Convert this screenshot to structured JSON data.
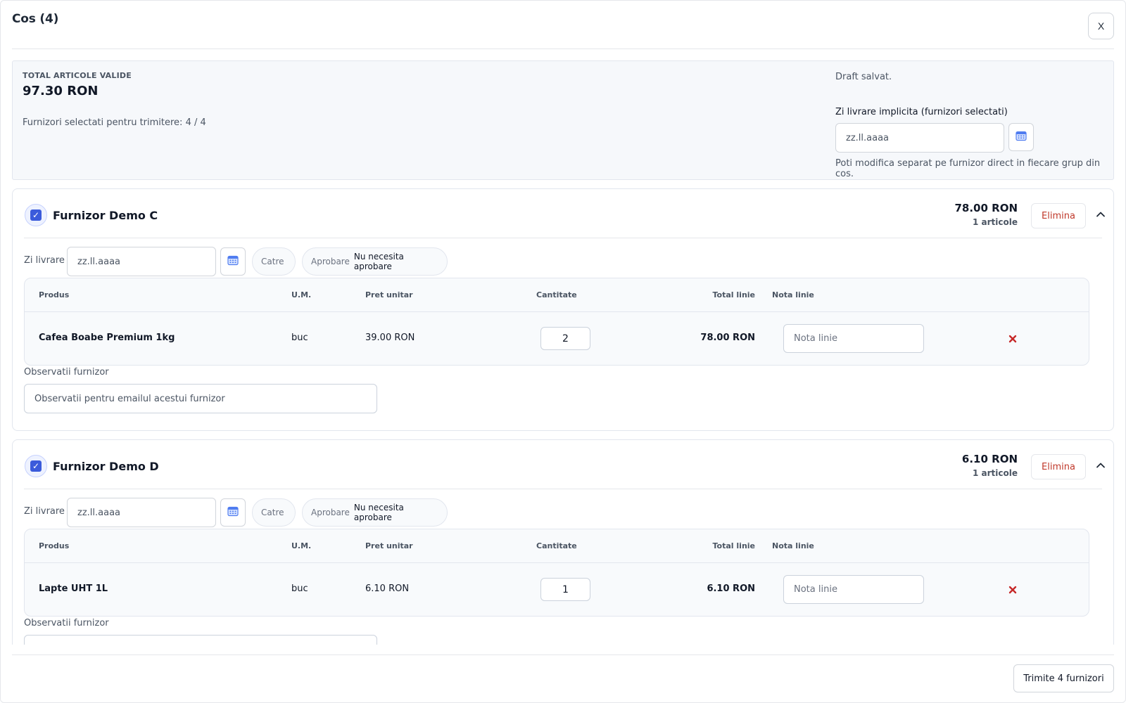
{
  "modal": {
    "title": "Cos (4)",
    "close_label": "X"
  },
  "summary": {
    "total_label": "TOTAL ARTICOLE VALIDE",
    "total_value": "97.30 RON",
    "suppliers_selected": "Furnizori selectati pentru trimitere: 4 / 4",
    "draft_status": "Draft salvat.",
    "default_day_label": "Zi livrare implicita (furnizori selectati)",
    "default_day_placeholder": "zz.ll.aaaa",
    "default_day_hint": "Poti modifica separat pe furnizor direct in fiecare grup din cos."
  },
  "table_headers": {
    "product": "Produs",
    "um": "U.M.",
    "unit_price": "Pret unitar",
    "quantity": "Cantitate",
    "line_total": "Total linie",
    "line_note": "Nota linie"
  },
  "suppliers": [
    {
      "name": "Furnizor Demo C",
      "selected": true,
      "total": "78.00 RON",
      "count": "1 articole",
      "remove_label": "Elimina",
      "delivery_label": "Zi livrare",
      "delivery_placeholder": "zz.ll.aaaa",
      "catre_placeholder": "Catre",
      "approval_key": "Aprobare",
      "approval_value": "Nu necesita aprobare",
      "items": [
        {
          "product": "Cafea Boabe Premium 1kg",
          "um": "buc",
          "unit_price": "39.00 RON",
          "quantity": "2",
          "line_total": "78.00 RON",
          "note_placeholder": "Nota linie"
        }
      ],
      "obs_label": "Observatii furnizor",
      "obs_placeholder": "Observatii pentru emailul acestui furnizor"
    },
    {
      "name": "Furnizor Demo D",
      "selected": true,
      "total": "6.10 RON",
      "count": "1 articole",
      "remove_label": "Elimina",
      "delivery_label": "Zi livrare",
      "delivery_placeholder": "zz.ll.aaaa",
      "catre_placeholder": "Catre",
      "approval_key": "Aprobare",
      "approval_value": "Nu necesita aprobare",
      "items": [
        {
          "product": "Lapte UHT 1L",
          "um": "buc",
          "unit_price": "6.10 RON",
          "quantity": "1",
          "line_total": "6.10 RON",
          "note_placeholder": "Nota linie"
        }
      ],
      "obs_label": "Observatii furnizor",
      "obs_placeholder": ""
    }
  ],
  "footer": {
    "send_label": "Trimite 4 furnizori"
  },
  "colors": {
    "accent": "#3b5bdb",
    "danger": "#c0392b",
    "calendar_icon": "#4f7cf0"
  },
  "icons": {
    "calendar": "calendar-icon",
    "check": "check-icon",
    "collapse": "chevron-up-icon",
    "delete_line": "close-x-icon"
  }
}
